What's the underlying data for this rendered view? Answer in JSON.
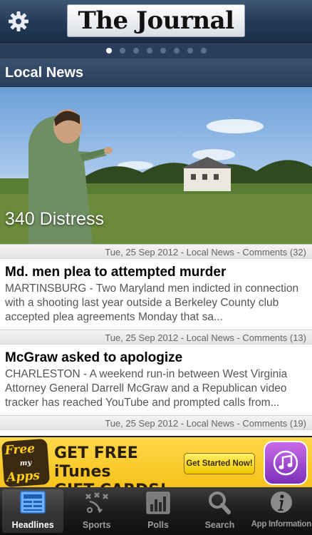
{
  "header": {
    "masthead": "The Journal",
    "page_count": 8,
    "active_page": 0
  },
  "section": {
    "title": "Local News"
  },
  "featured": {
    "title": "340 Distress",
    "meta": "Tue, 25 Sep 2012 - Local News - Comments (32)"
  },
  "stories": [
    {
      "headline": "Md. men plea to attempted murder",
      "summary": "MARTINSBURG - Two Maryland men indicted in connection with a shooting last year outside a Berkeley County club accepted plea agreements Monday that sa...",
      "meta": "Tue, 25 Sep 2012 - Local News - Comments (13)"
    },
    {
      "headline": "McGraw asked to apologize",
      "summary": "CHARLESTON - A weekend run-in between West Virginia Attorney General Darrell McGraw and a Republican video tracker has reached YouTube and prompted calls from...",
      "meta": "Tue, 25 Sep 2012 - Local News - Comments (19)"
    }
  ],
  "ad": {
    "logo_line1": "Free",
    "logo_line2": "my",
    "logo_line3": "Apps",
    "headline_line1": "GET FREE iTunes",
    "headline_line2": "GIFT CARDS!",
    "cta": "Get Started Now!",
    "icon": "music-note-icon"
  },
  "tabs": [
    {
      "label": "Headlines",
      "icon": "newspaper-icon",
      "active": true
    },
    {
      "label": "Sports",
      "icon": "playbook-icon",
      "active": false
    },
    {
      "label": "Polls",
      "icon": "bar-chart-icon",
      "active": false
    },
    {
      "label": "Search",
      "icon": "magnifier-icon",
      "active": false
    },
    {
      "label": "App Information",
      "icon": "info-icon",
      "active": false
    }
  ],
  "colors": {
    "header": "#233a57",
    "tabbar": "#1c1c1c",
    "ad_background": "#f6c21a"
  }
}
